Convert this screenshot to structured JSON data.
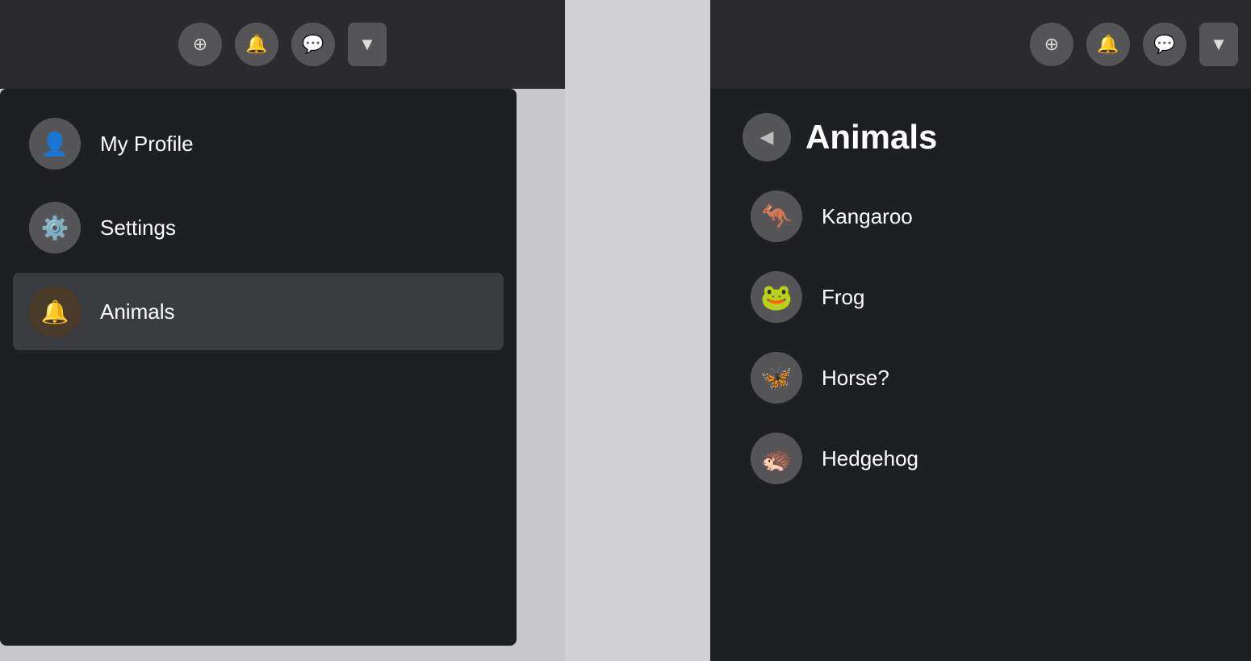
{
  "left_topbar": {
    "add_label": "+",
    "bell_label": "🔔",
    "chat_label": "💬",
    "dropdown_label": "▼"
  },
  "right_topbar": {
    "add_label": "+",
    "bell_label": "🔔",
    "chat_label": "💬",
    "dropdown_label": "▼"
  },
  "menu": {
    "items": [
      {
        "id": "my-profile",
        "label": "My Profile",
        "icon": "👤",
        "active": false
      },
      {
        "id": "settings",
        "label": "Settings",
        "icon": "⚙️",
        "active": false
      },
      {
        "id": "animals",
        "label": "Animals",
        "icon": "🔔",
        "active": true
      }
    ]
  },
  "animals_panel": {
    "back_icon": "◀",
    "title": "Animals",
    "items": [
      {
        "id": "kangaroo",
        "label": "Kangaroo",
        "icon": "🦘"
      },
      {
        "id": "frog",
        "label": "Frog",
        "icon": "🐸"
      },
      {
        "id": "horse",
        "label": "Horse?",
        "icon": "🦋"
      },
      {
        "id": "hedgehog",
        "label": "Hedgehog",
        "icon": "🦔"
      }
    ]
  }
}
